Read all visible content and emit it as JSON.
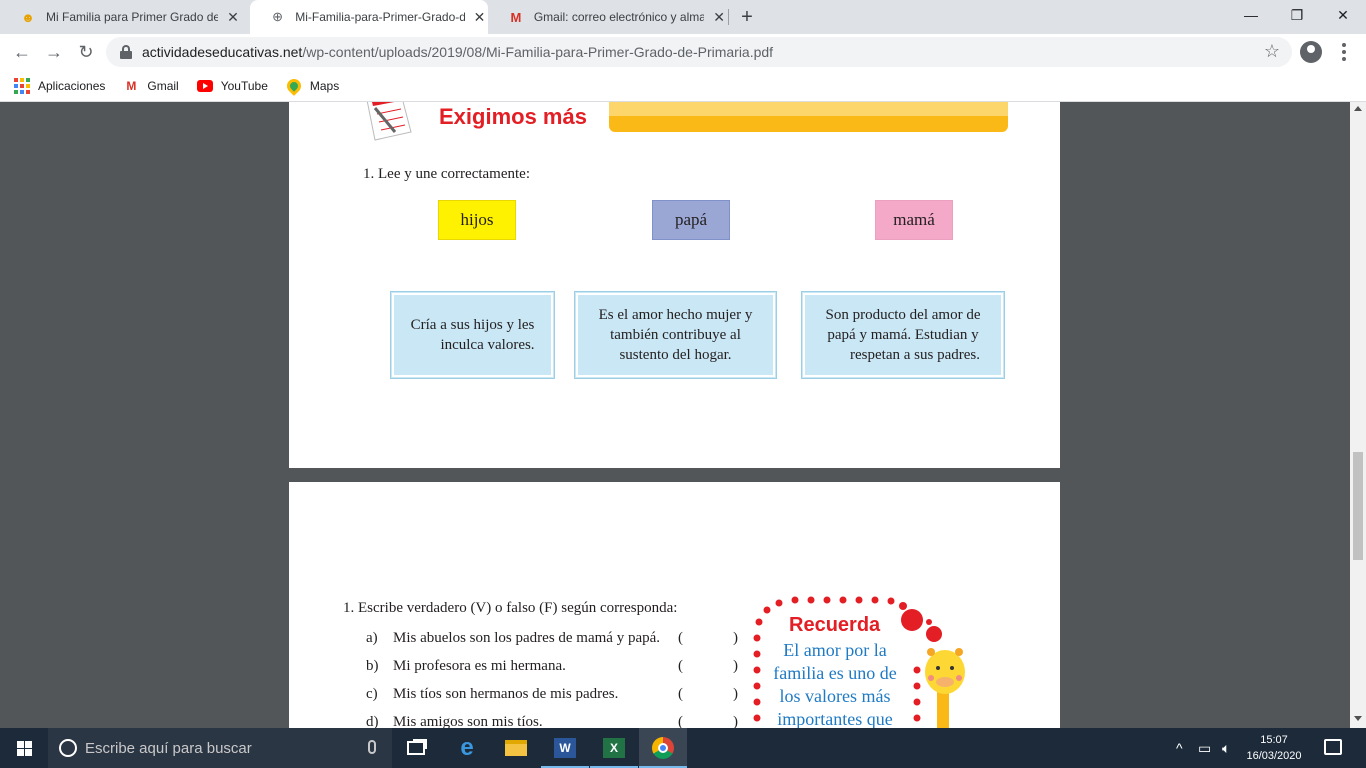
{
  "tabs": [
    {
      "title": "Mi Familia para Primer Grado de",
      "favicon": "smiley-icon"
    },
    {
      "title": "Mi-Familia-para-Primer-Grado-de",
      "favicon": "globe-icon"
    },
    {
      "title": "Gmail: correo electrónico y almac",
      "favicon": "gmail-icon"
    }
  ],
  "address": {
    "host": "actividadeseducativas.net",
    "path": "/wp-content/uploads/2019/08/Mi-Familia-para-Primer-Grado-de-Primaria.pdf"
  },
  "bookmarks": [
    {
      "label": "Aplicaciones",
      "icon": "apps-grid-icon"
    },
    {
      "label": "Gmail",
      "icon": "gmail-icon"
    },
    {
      "label": "YouTube",
      "icon": "youtube-icon"
    },
    {
      "label": "Maps",
      "icon": "maps-icon"
    }
  ],
  "page1": {
    "section_title": "Exigimos más",
    "instruction": "1.   Lee y une correctamente:",
    "words": [
      {
        "text": "hijos",
        "color": "#fff200"
      },
      {
        "text": "papá",
        "color": "#9aa7d5"
      },
      {
        "text": "mamá",
        "color": "#f4a9c8"
      }
    ],
    "descriptions": [
      {
        "line1": "Cría a sus hijos y les",
        "line2": "inculca valores.",
        "line3": ""
      },
      {
        "line1": "Es el amor hecho mujer y",
        "line2": "también contribuye al",
        "line3": "sustento del hogar."
      },
      {
        "line1": "Son producto del amor de",
        "line2": "papá y mamá. Estudian y",
        "line3": "respetan a sus padres."
      }
    ]
  },
  "page2": {
    "instruction": "1.   Escribe verdadero (V) o falso (F) según corresponda:",
    "items": [
      {
        "letter": "a)",
        "text": "Mis abuelos son los padres de mamá y papá.",
        "open": "(",
        "close": ")"
      },
      {
        "letter": "b)",
        "text": "Mi profesora es mi hermana.",
        "open": "(",
        "close": ")"
      },
      {
        "letter": "c)",
        "text": "Mis tíos son hermanos de mis padres.",
        "open": "(",
        "close": ")"
      },
      {
        "letter": "d)",
        "text": "Mis amigos son mis tíos.",
        "open": "(",
        "close": ")"
      }
    ],
    "recuerda": {
      "title": "Recuerda",
      "line1": "El amor por la",
      "line2": "familia es uno de",
      "line3": "los valores más",
      "line4": "importantes que"
    }
  },
  "taskbar": {
    "search_placeholder": "Escribe aquí para buscar",
    "time": "15:07",
    "date": "16/03/2020",
    "apps": [
      "task-view-icon",
      "edge-icon",
      "file-explorer-icon",
      "word-icon",
      "excel-icon",
      "chrome-icon"
    ]
  }
}
